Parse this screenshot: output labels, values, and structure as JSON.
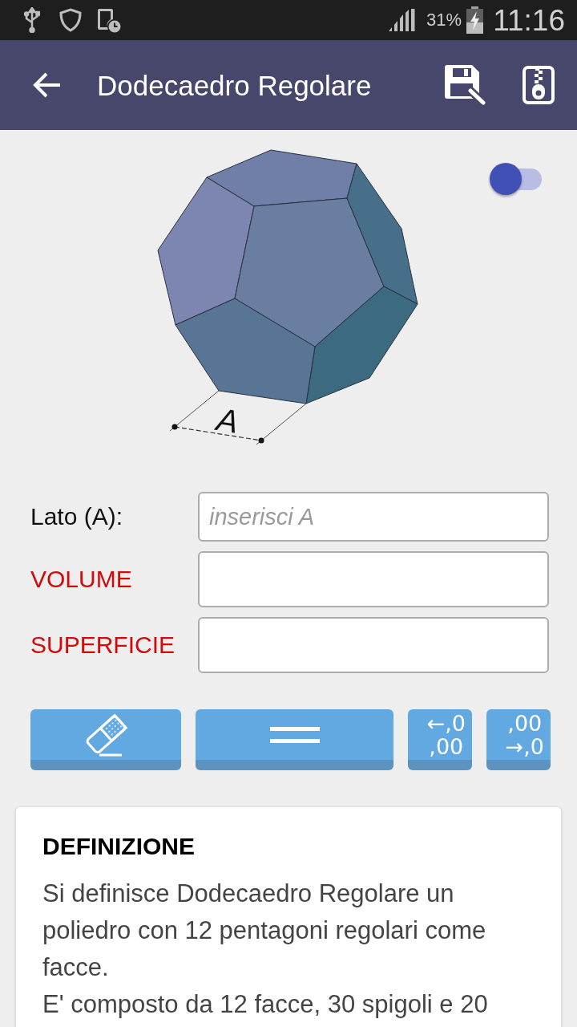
{
  "status_bar": {
    "battery_percent": "31%",
    "time": "11:16"
  },
  "app_bar": {
    "title": "Dodecaedro Regolare"
  },
  "figure": {
    "edge_label": "A",
    "switch": {
      "on": false
    }
  },
  "form": {
    "fields": [
      {
        "kind": "input",
        "label": "Lato (A):",
        "placeholder": "inserisci A"
      },
      {
        "kind": "result",
        "label": "VOLUME"
      },
      {
        "kind": "result",
        "label": "SUPERFICIE"
      }
    ]
  },
  "buttons": [
    {
      "kind": "eraser"
    },
    {
      "kind": "equals"
    },
    {
      "kind": "text",
      "lines": [
        "←,0",
        ",00"
      ]
    },
    {
      "kind": "text",
      "lines": [
        ",00",
        "→,0"
      ]
    }
  ],
  "definition": {
    "title": "DEFINIZIONE",
    "paragraphs": [
      "Si definisce Dodecaedro Regolare un poliedro con 12 pentagoni regolari come facce.",
      "E' composto da 12 facce, 30 spigoli e 20"
    ]
  }
}
